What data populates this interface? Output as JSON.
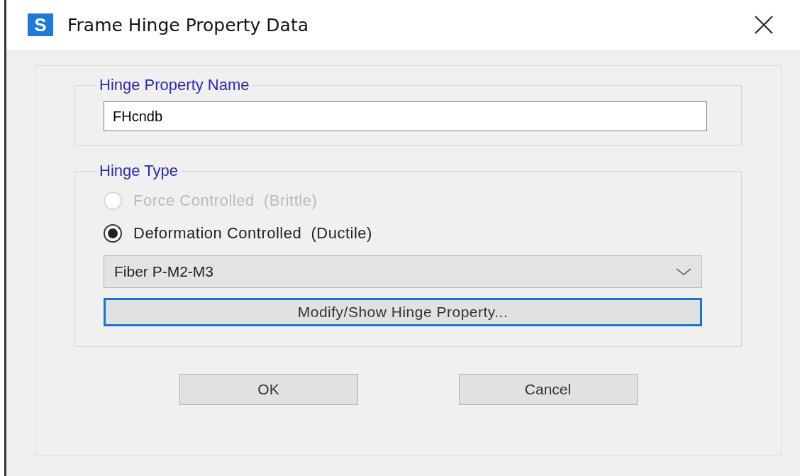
{
  "window": {
    "logo": "S",
    "title": "Frame Hinge Property Data"
  },
  "name_group": {
    "legend": "Hinge Property Name",
    "value": "FHcndb"
  },
  "type_group": {
    "legend": "Hinge Type",
    "options": [
      {
        "label": "Force Controlled  (Brittle)",
        "selected": false,
        "disabled": true
      },
      {
        "label": "Deformation Controlled  (Ductile)",
        "selected": true,
        "disabled": false
      }
    ],
    "dropdown": {
      "value": "Fiber P-M2-M3"
    },
    "modify_button": {
      "label": "Modify/Show Hinge Property...",
      "focused": true
    }
  },
  "buttons": [
    "OK",
    "Cancel"
  ]
}
